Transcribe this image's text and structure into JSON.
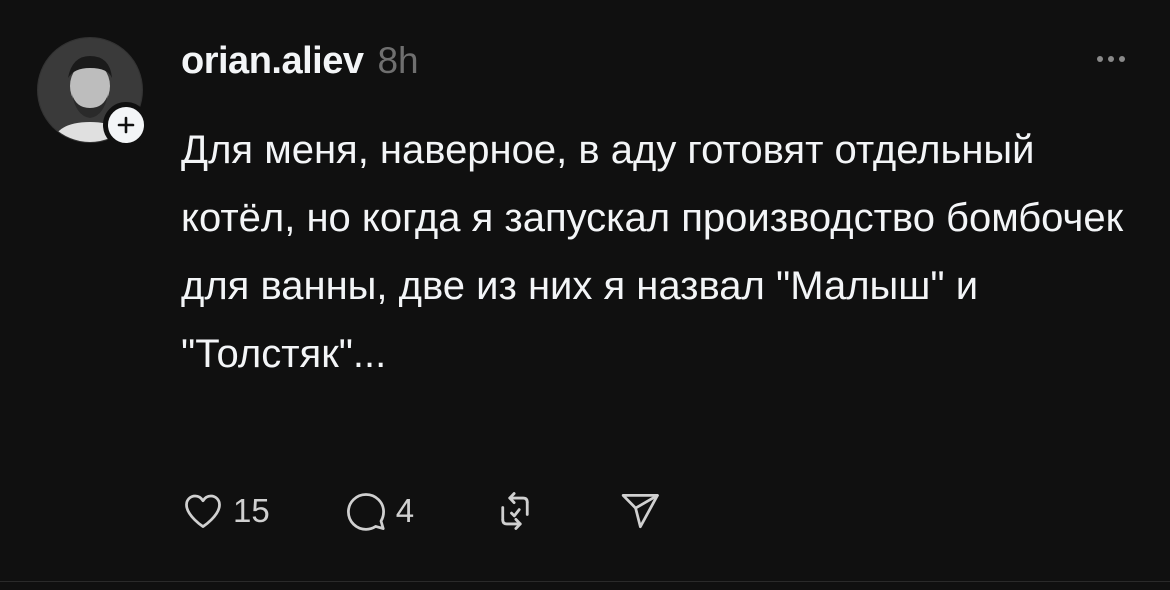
{
  "post": {
    "username": "orian.aliev",
    "timestamp": "8h",
    "text": "Для меня, наверное, в аду готовят отдельный котёл, но когда я запускал производство бомбочек для ванны, две из них я назвал \"Малыш\" и \"Толстяк\"...",
    "likes_count": "15",
    "replies_count": "4"
  },
  "icons": {
    "avatar": "user-avatar-photo",
    "follow": "plus-icon",
    "more": "more-horizontal-icon",
    "like": "heart-icon",
    "reply": "comment-bubble-icon",
    "repost": "repost-icon",
    "share": "send-icon"
  },
  "colors": {
    "background": "#101010",
    "text_primary": "#f3f5f7",
    "text_secondary": "#6f6f6f",
    "icon": "#d0d0d0"
  }
}
